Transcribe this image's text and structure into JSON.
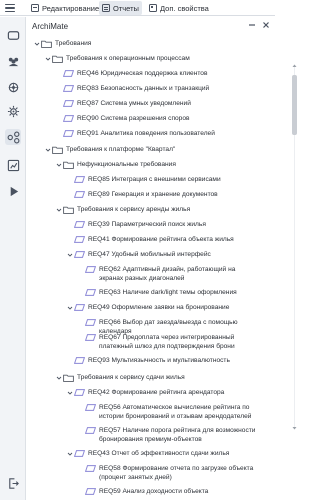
{
  "toolbar": {
    "edit_label": "Редактирование",
    "reports_label": "Отчеты",
    "props_label": "Доп. свойства"
  },
  "panel": {
    "title": "ArchiMate"
  },
  "colors": {
    "requirement_icon": "#8a86d6",
    "folder_icon": "#555b66",
    "active_bg": "#e4e8ee"
  },
  "tree": [
    {
      "label": "Требования",
      "type": "folder",
      "expanded": true
    },
    {
      "label": "Требования к операционным процессам",
      "type": "folder",
      "expanded": true
    },
    {
      "label": "REQ46 Юридическая поддержка клиентов",
      "type": "req"
    },
    {
      "label": "REQ83 Безопасность данных и транзакций",
      "type": "req"
    },
    {
      "label": "REQ87 Система умных уведомлений",
      "type": "req"
    },
    {
      "label": "REQ90 Система разрешения споров",
      "type": "req"
    },
    {
      "label": "REQ91 Аналитика поведения пользователей",
      "type": "req"
    },
    {
      "label": "Требования к платформе \"Квартал\"",
      "type": "folder",
      "expanded": true
    },
    {
      "label": "Нефункциональные требования",
      "type": "folder",
      "expanded": true
    },
    {
      "label": "REQ85 Интеграция с внешними сервисами",
      "type": "req"
    },
    {
      "label": "REQ89 Генерация и хранение документов",
      "type": "req"
    },
    {
      "label": "Требования к сервису аренды жилья",
      "type": "folder",
      "expanded": true
    },
    {
      "label": "REQ39 Параметрический поиск жилья",
      "type": "req"
    },
    {
      "label": "REQ41 Формирование рейтинга объекта жилья",
      "type": "req"
    },
    {
      "label": "REQ47 Удобный мобильный интерфейс",
      "type": "req",
      "expanded": true
    },
    {
      "label": "REQ62 Адаптивный дизайн, работающий на экранах разных диагоналей",
      "type": "req"
    },
    {
      "label": "REQ63 Наличие dark/light темы оформления",
      "type": "req"
    },
    {
      "label": "REQ49 Оформление заявки на бронирование",
      "type": "req",
      "expanded": true
    },
    {
      "label": "REQ66 Выбор дат заезда/выезда с помощью календаря",
      "type": "req"
    },
    {
      "label": "REQ67 Предоплата через интегрированный платежный шлюз для подтверждения брони",
      "type": "req"
    },
    {
      "label": "REQ93 Мультиязычность и мультивалютность",
      "type": "req"
    },
    {
      "label": "Требования к сервису сдачи жилья",
      "type": "folder",
      "expanded": true
    },
    {
      "label": "REQ42 Формирование рейтинга арендатора",
      "type": "req",
      "expanded": true
    },
    {
      "label": "REQ56 Автоматическое вычисление рейтинга по истории бронирований и отзывам арендодателей",
      "type": "req"
    },
    {
      "label": "REQ57 Наличие порога рейтинга для возможности бронирования премиум-объектов",
      "type": "req"
    },
    {
      "label": "REQ43 Отчет об эффективности сдачи жилья",
      "type": "req",
      "expanded": true
    },
    {
      "label": "REQ58 Формирование отчета по загрузке объекта (процент занятых дней)",
      "type": "req"
    },
    {
      "label": "REQ59 Анализ доходности объекта",
      "type": "req"
    }
  ]
}
